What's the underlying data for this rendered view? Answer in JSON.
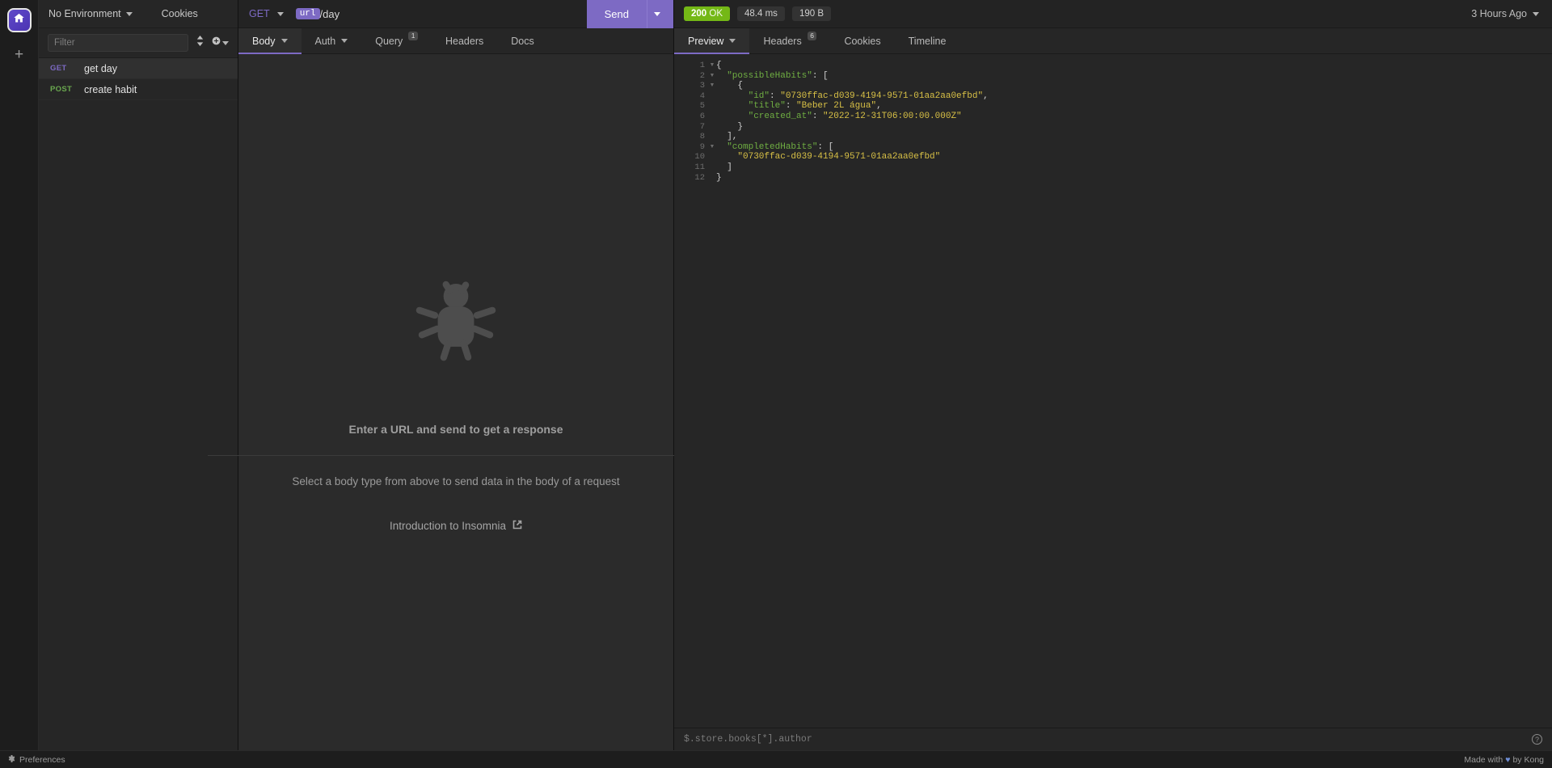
{
  "rail": {
    "home_icon": "home-icon",
    "add_icon": "plus-icon"
  },
  "sidebar": {
    "environment": "No Environment",
    "cookies": "Cookies",
    "filter_placeholder": "Filter",
    "sort_icon": "sort-icon",
    "add_icon": "plus-circle-icon",
    "requests": [
      {
        "method": "GET",
        "name": "get day",
        "active": true
      },
      {
        "method": "POST",
        "name": "create habit",
        "active": false
      }
    ]
  },
  "request": {
    "method": "GET",
    "url_template": "url",
    "url_path": "/day",
    "send_label": "Send",
    "tabs": [
      {
        "label": "Body",
        "caret": true,
        "badge": "",
        "active": true
      },
      {
        "label": "Auth",
        "caret": true,
        "badge": "",
        "active": false
      },
      {
        "label": "Query",
        "caret": false,
        "badge": "1",
        "active": false
      },
      {
        "label": "Headers",
        "caret": false,
        "badge": "",
        "active": false
      },
      {
        "label": "Docs",
        "caret": false,
        "badge": "",
        "active": false
      }
    ],
    "empty": {
      "title": "Enter a URL and send to get a response",
      "subtitle": "Select a body type from above to send data in the body of a request",
      "link": "Introduction to Insomnia",
      "bug_icon": "bug-icon",
      "external_icon": "external-link-icon"
    }
  },
  "response": {
    "status_code": "200",
    "status_text": "OK",
    "status_color": "#74b816",
    "time": "48.4 ms",
    "size": "190 B",
    "last_run": "3 Hours Ago",
    "tabs": [
      {
        "label": "Preview",
        "caret": true,
        "badge": "",
        "active": true
      },
      {
        "label": "Headers",
        "caret": false,
        "badge": "6",
        "active": false
      },
      {
        "label": "Cookies",
        "caret": false,
        "badge": "",
        "active": false
      },
      {
        "label": "Timeline",
        "caret": false,
        "badge": "",
        "active": false
      }
    ],
    "body_lines": [
      {
        "n": "1",
        "fold": true,
        "indent": 0,
        "segments": [
          {
            "t": "{",
            "c": "p"
          }
        ]
      },
      {
        "n": "2",
        "fold": true,
        "indent": 1,
        "segments": [
          {
            "t": "\"possibleHabits\"",
            "c": "k"
          },
          {
            "t": ": [",
            "c": "p"
          }
        ]
      },
      {
        "n": "3",
        "fold": true,
        "indent": 2,
        "segments": [
          {
            "t": "{",
            "c": "p"
          }
        ]
      },
      {
        "n": "4",
        "fold": false,
        "indent": 3,
        "segments": [
          {
            "t": "\"id\"",
            "c": "k"
          },
          {
            "t": ": ",
            "c": "p"
          },
          {
            "t": "\"0730ffac-d039-4194-9571-01aa2aa0efbd\"",
            "c": "s"
          },
          {
            "t": ",",
            "c": "p"
          }
        ]
      },
      {
        "n": "5",
        "fold": false,
        "indent": 3,
        "segments": [
          {
            "t": "\"title\"",
            "c": "k"
          },
          {
            "t": ": ",
            "c": "p"
          },
          {
            "t": "\"Beber 2L água\"",
            "c": "s"
          },
          {
            "t": ",",
            "c": "p"
          }
        ]
      },
      {
        "n": "6",
        "fold": false,
        "indent": 3,
        "segments": [
          {
            "t": "\"created_at\"",
            "c": "k"
          },
          {
            "t": ": ",
            "c": "p"
          },
          {
            "t": "\"2022-12-31T06:00:00.000Z\"",
            "c": "s"
          }
        ]
      },
      {
        "n": "7",
        "fold": false,
        "indent": 2,
        "segments": [
          {
            "t": "}",
            "c": "p"
          }
        ]
      },
      {
        "n": "8",
        "fold": false,
        "indent": 1,
        "segments": [
          {
            "t": "],",
            "c": "p"
          }
        ]
      },
      {
        "n": "9",
        "fold": true,
        "indent": 1,
        "segments": [
          {
            "t": "\"completedHabits\"",
            "c": "k"
          },
          {
            "t": ": [",
            "c": "p"
          }
        ]
      },
      {
        "n": "10",
        "fold": false,
        "indent": 2,
        "segments": [
          {
            "t": "\"0730ffac-d039-4194-9571-01aa2aa0efbd\"",
            "c": "s"
          }
        ]
      },
      {
        "n": "11",
        "fold": false,
        "indent": 1,
        "segments": [
          {
            "t": "]",
            "c": "p"
          }
        ]
      },
      {
        "n": "12",
        "fold": false,
        "indent": 0,
        "segments": [
          {
            "t": "}",
            "c": "p"
          }
        ]
      }
    ],
    "jsonpath_placeholder": "$.store.books[*].author",
    "help_icon": "question-mark-icon"
  },
  "footer": {
    "preferences": "Preferences",
    "gear_icon": "gear-icon",
    "made_prefix": "Made with",
    "heart_icon": "heart-icon",
    "made_suffix": "by Kong"
  }
}
